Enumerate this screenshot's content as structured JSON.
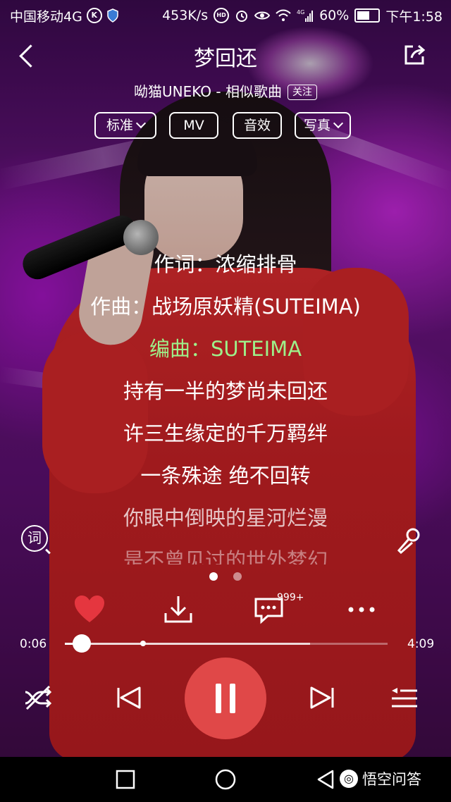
{
  "status_bar": {
    "carrier": "中国移动4G",
    "carrier_badge": "K",
    "net_speed": "453K/s",
    "hd_badge": "HD",
    "signal_label": "4G",
    "battery": "60%",
    "time": "下午1:58"
  },
  "header": {
    "title": "梦回还",
    "artist_line": "呦猫UNEKO - 相似歌曲",
    "follow_label": "关注"
  },
  "options": {
    "quality": "标准",
    "mv": "MV",
    "effects": "音效",
    "photo": "写真"
  },
  "lyrics": [
    "作词：浓缩排骨",
    "作曲：战场原妖精(SUTEIMA)",
    "编曲：SUTEIMA",
    "持有一半的梦尚未回还",
    "许三生缘定的千万羁绊",
    "一条殊途 绝不回转",
    "你眼中倒映的星河烂漫",
    "是不曾见过的世外梦幻"
  ],
  "lyrics_toggle_label": "词",
  "actions": {
    "comment_count": "999+"
  },
  "progress": {
    "elapsed": "0:06",
    "duration": "4:09",
    "played_fraction": 0.024,
    "buffered_fraction": 0.76
  },
  "watermark": {
    "text": "悟空问答"
  },
  "colors": {
    "accent": "#e04848",
    "active_lyric": "#9ef08a"
  }
}
